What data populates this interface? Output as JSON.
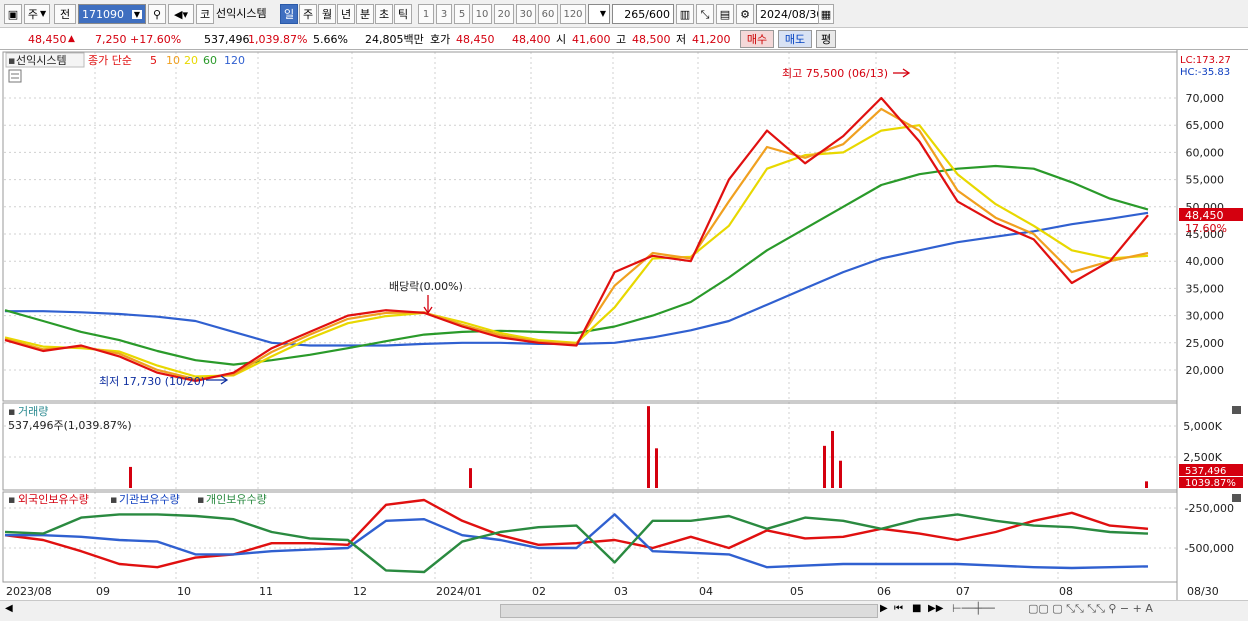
{
  "toolbar": {
    "type_label": "주",
    "prev_label": "전",
    "code_value": "171090",
    "market_label": "코",
    "stock_name": "선익시스템",
    "periods": [
      "일",
      "주",
      "월",
      "년",
      "분",
      "초",
      "틱"
    ],
    "selected_period": "일",
    "intervals": [
      "1",
      "3",
      "5",
      "10",
      "20",
      "30",
      "60",
      "120"
    ],
    "count_value": "265",
    "count_total": "/600",
    "date_value": "2024/08/30"
  },
  "infobar": {
    "price": "48,450",
    "change_arrow": "▲",
    "change": "7,250",
    "change_pct": "+17.60%",
    "volume": "537,496",
    "volume_ratio": "1,039.87%",
    "turnover_pct": "5.66%",
    "amount": "24,805백만",
    "quote_label": "호가",
    "ask": "48,450",
    "bid": "48,400",
    "open_label": "시",
    "open": "41,600",
    "high_label": "고",
    "high": "48,500",
    "low_label": "저",
    "low": "41,200",
    "buy_label": "매수",
    "sell_label": "매도",
    "eval_label": "평"
  },
  "price_panel": {
    "name_tag": "선익시스템",
    "legend_prefix": "종가 단순",
    "ma_labels": [
      "5",
      "10",
      "20",
      "60",
      "120"
    ],
    "ma_colors": [
      "#e01010",
      "#f0a020",
      "#e8d800",
      "#2a9a2a",
      "#3060d0"
    ],
    "lc_label": "LC:173.27",
    "hc_label": "HC:-35.83",
    "high_annotation": "최고 75,500 (06/13)",
    "low_annotation": "최저 17,730 (10/20)",
    "dividend_annotation": "배당락(0.00%)",
    "current_price_tag": "48,450",
    "current_pct_tag": "17.60%"
  },
  "volume_panel": {
    "title": "거래량",
    "value_label": "537,496주(1,039.87%)",
    "current_tag": "537,496",
    "ratio_tag": "1039.87%"
  },
  "holdings_panel": {
    "legend": [
      "외국인보유수량",
      "기관보유수량",
      "개인보유수량"
    ],
    "colors": [
      "#e01010",
      "#3060d0",
      "#2a8a40"
    ]
  },
  "x_axis_labels": [
    "2023/08",
    "09",
    "10",
    "11",
    "12",
    "2024/01",
    "02",
    "03",
    "04",
    "05",
    "06",
    "07",
    "08",
    "08/30"
  ],
  "chart_data": {
    "type": "line",
    "title": "선익시스템",
    "price_axis": {
      "ticks": [
        20000,
        25000,
        30000,
        35000,
        40000,
        45000,
        50000,
        55000,
        60000,
        65000,
        70000
      ],
      "tick_labels": [
        "20,000",
        "25,000",
        "30,000",
        "35,000",
        "40,000",
        "45,000",
        "50,000",
        "55,000",
        "60,000",
        "65,000",
        "70,000"
      ],
      "range": [
        15000,
        75500
      ]
    },
    "price_series_x": [
      "2023/08",
      "2023/08",
      "09",
      "09",
      "10",
      "10",
      "11",
      "11",
      "12",
      "12",
      "2024/01",
      "2024/01",
      "02",
      "02",
      "03",
      "03",
      "03",
      "04",
      "04",
      "05",
      "05",
      "05",
      "06",
      "06",
      "06",
      "07",
      "07",
      "08",
      "08",
      "08",
      "08/30"
    ],
    "series": [
      {
        "name": "5",
        "values": [
          25500,
          23500,
          24500,
          22500,
          19500,
          18000,
          19500,
          24000,
          27000,
          30000,
          31000,
          30500,
          28000,
          26000,
          25000,
          24500,
          38000,
          41000,
          40000,
          55000,
          64000,
          58000,
          63000,
          70000,
          62000,
          51000,
          47000,
          44000,
          36000,
          40000,
          48450
        ]
      },
      {
        "name": "10",
        "values": [
          25700,
          23800,
          24300,
          23000,
          20000,
          18300,
          19200,
          23300,
          26500,
          29400,
          30500,
          30600,
          28300,
          26400,
          25200,
          24800,
          35500,
          41500,
          40500,
          51000,
          61000,
          59000,
          61500,
          68000,
          64000,
          53000,
          48000,
          45000,
          38000,
          40000,
          41500
        ]
      },
      {
        "name": "20",
        "values": [
          26000,
          24300,
          24000,
          23400,
          20800,
          18800,
          19000,
          22500,
          25800,
          28600,
          29900,
          30500,
          28800,
          26800,
          25500,
          25000,
          31500,
          40500,
          40800,
          46500,
          57000,
          59500,
          60000,
          64000,
          65000,
          56000,
          50500,
          46500,
          42000,
          40500,
          41000
        ]
      },
      {
        "name": "60",
        "values": [
          31000,
          29000,
          27000,
          25500,
          23500,
          21800,
          21000,
          21800,
          22800,
          24000,
          25300,
          26500,
          27000,
          27200,
          27000,
          26800,
          28000,
          30000,
          32500,
          37000,
          42000,
          46000,
          50000,
          54000,
          56000,
          57000,
          57500,
          57000,
          54500,
          51500,
          49500
        ]
      },
      {
        "name": "120",
        "values": [
          30800,
          30800,
          30600,
          30300,
          29800,
          29000,
          27000,
          25000,
          24500,
          24500,
          24500,
          24800,
          25000,
          25000,
          24800,
          24800,
          25000,
          26000,
          27300,
          29000,
          32000,
          35000,
          38000,
          40500,
          42000,
          43500,
          44500,
          45500,
          46800,
          47800,
          48900
        ]
      }
    ],
    "volume_axis": {
      "ticks": [
        2500000,
        5000000
      ],
      "tick_labels": [
        "2,500K",
        "5,000K"
      ]
    },
    "volume_spikes": [
      {
        "x": "09",
        "value": 1700000
      },
      {
        "x": "2024/01",
        "value": 1600000
      },
      {
        "x": "03",
        "value": 6600000
      },
      {
        "x": "03",
        "value": 3200000
      },
      {
        "x": "05",
        "value": 3400000
      },
      {
        "x": "05",
        "value": 4600000
      },
      {
        "x": "05",
        "value": 2200000
      },
      {
        "x": "08/30",
        "value": 537496
      }
    ],
    "holdings_axis": {
      "ticks": [
        -250000,
        -500000
      ],
      "tick_labels": [
        "-250,000",
        "-500,000"
      ]
    },
    "holdings_series": [
      {
        "name": "외국인보유수량",
        "values": [
          -420000,
          -450000,
          -520000,
          -600000,
          -620000,
          -560000,
          -540000,
          -470000,
          -470000,
          -480000,
          -230000,
          -200000,
          -330000,
          -420000,
          -480000,
          -470000,
          -450000,
          -500000,
          -430000,
          -500000,
          -390000,
          -440000,
          -430000,
          -380000,
          -410000,
          -450000,
          -400000,
          -330000,
          -280000,
          -360000,
          -380000
        ]
      },
      {
        "name": "기관보유수량",
        "values": [
          -420000,
          -420000,
          -430000,
          -450000,
          -460000,
          -540000,
          -540000,
          -520000,
          -510000,
          -500000,
          -330000,
          -320000,
          -420000,
          -450000,
          -500000,
          -500000,
          -290000,
          -520000,
          -530000,
          -540000,
          -620000,
          -610000,
          -600000,
          -600000,
          -600000,
          -600000,
          -610000,
          -620000,
          -625000,
          -620000,
          -615000
        ]
      },
      {
        "name": "개인보유수량",
        "values": [
          -400000,
          -410000,
          -310000,
          -290000,
          -290000,
          -300000,
          -320000,
          -400000,
          -440000,
          -450000,
          -640000,
          -650000,
          -460000,
          -400000,
          -370000,
          -360000,
          -590000,
          -330000,
          -330000,
          -300000,
          -380000,
          -310000,
          -330000,
          -380000,
          -320000,
          -290000,
          -330000,
          -360000,
          -370000,
          -400000,
          -410000
        ]
      }
    ]
  }
}
